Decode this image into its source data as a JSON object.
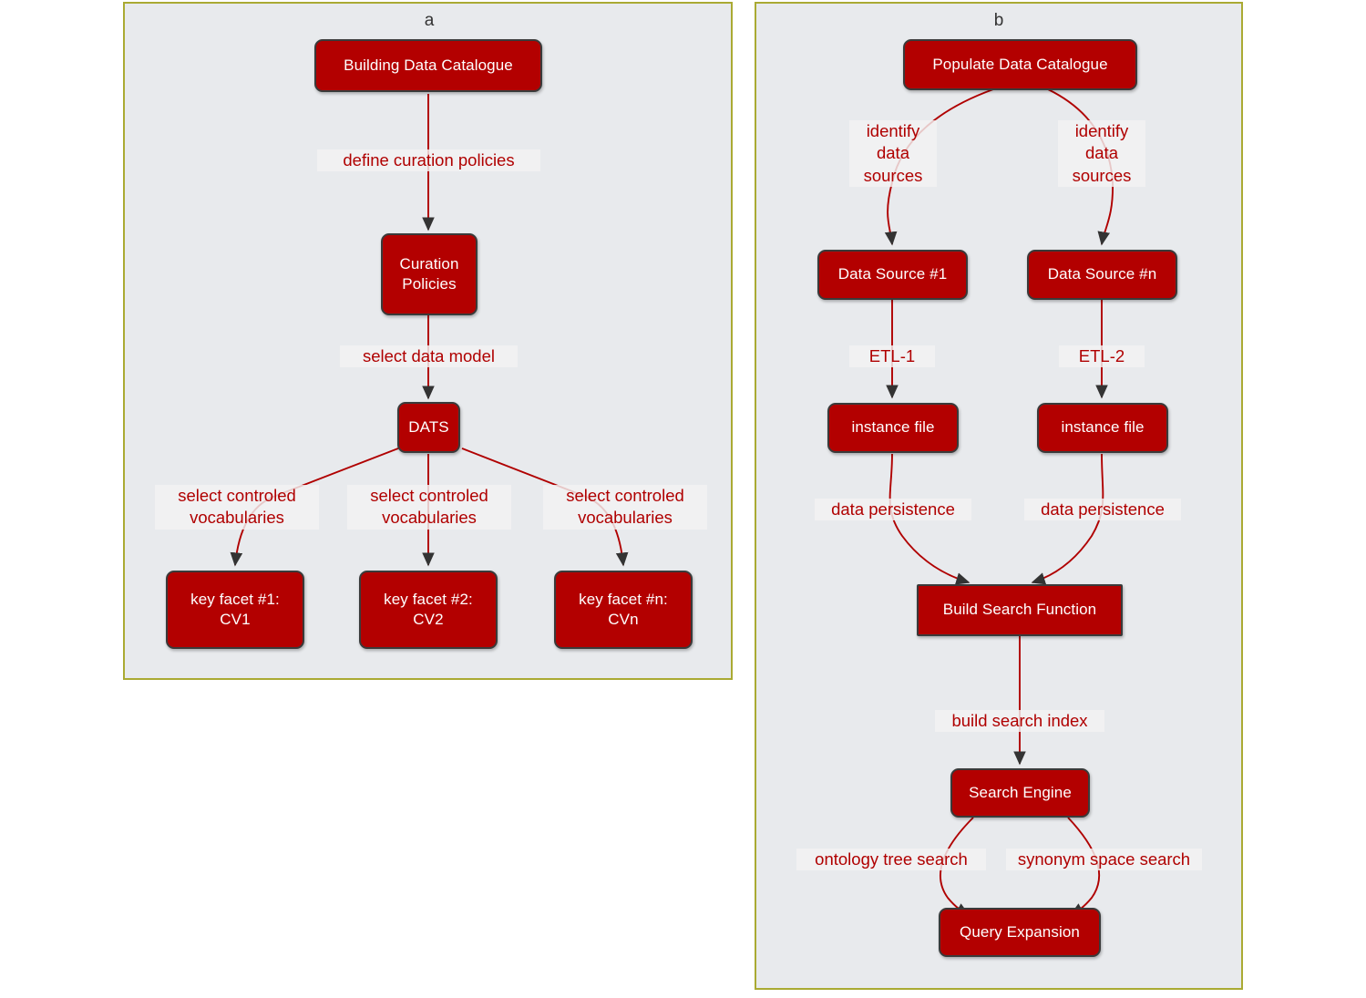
{
  "figure": {
    "background": "#ffffff",
    "panel_fill": "#e8eaed",
    "panel_border": "#aaaa33",
    "node_fill": "#b30000",
    "node_border": "#3a3a3a",
    "node_text": "#ffffff",
    "edge_color": "#b00000",
    "label_text_color": "#b00000"
  },
  "panels": [
    {
      "id": "a",
      "label": "a"
    },
    {
      "id": "b",
      "label": "b"
    }
  ],
  "panel_a": {
    "label": "a",
    "nodes": [
      {
        "id": "building-data-catalogue",
        "text": "Building Data Catalogue"
      },
      {
        "id": "curation-policies",
        "text": "Curation\nPolicies"
      },
      {
        "id": "dats",
        "text": "DATS"
      },
      {
        "id": "key-facet-1",
        "text": "key facet #1:\nCV1"
      },
      {
        "id": "key-facet-2",
        "text": "key facet #2:\nCV2"
      },
      {
        "id": "key-facet-n",
        "text": "key facet #n:\nCVn"
      }
    ],
    "edges": [
      {
        "from": "building-data-catalogue",
        "to": "curation-policies",
        "label": "define curation policies"
      },
      {
        "from": "curation-policies",
        "to": "dats",
        "label": "select data model"
      },
      {
        "from": "dats",
        "to": "key-facet-1",
        "label": "select controled\nvocabularies"
      },
      {
        "from": "dats",
        "to": "key-facet-2",
        "label": "select controled\nvocabularies"
      },
      {
        "from": "dats",
        "to": "key-facet-n",
        "label": "select controled\nvocabularies"
      }
    ]
  },
  "panel_b": {
    "label": "b",
    "nodes": [
      {
        "id": "populate-data-catalogue",
        "text": "Populate Data Catalogue"
      },
      {
        "id": "data-source-1",
        "text": "Data Source #1"
      },
      {
        "id": "data-source-n",
        "text": "Data Source #n"
      },
      {
        "id": "instance-file-1",
        "text": "instance file"
      },
      {
        "id": "instance-file-2",
        "text": "instance file"
      },
      {
        "id": "build-search-function",
        "text": "Build Search Function"
      },
      {
        "id": "search-engine",
        "text": "Search Engine"
      },
      {
        "id": "query-expansion",
        "text": "Query Expansion"
      }
    ],
    "edges": [
      {
        "from": "populate-data-catalogue",
        "to": "data-source-1",
        "label": "identify\ndata\nsources"
      },
      {
        "from": "populate-data-catalogue",
        "to": "data-source-n",
        "label": "identify\ndata\nsources"
      },
      {
        "from": "data-source-1",
        "to": "instance-file-1",
        "label": "ETL-1"
      },
      {
        "from": "data-source-n",
        "to": "instance-file-2",
        "label": "ETL-2"
      },
      {
        "from": "instance-file-1",
        "to": "build-search-function",
        "label": "data persistence"
      },
      {
        "from": "instance-file-2",
        "to": "build-search-function",
        "label": "data persistence"
      },
      {
        "from": "build-search-function",
        "to": "search-engine",
        "label": "build search index"
      },
      {
        "from": "search-engine",
        "to": "query-expansion",
        "label": "ontology tree search"
      },
      {
        "from": "search-engine",
        "to": "query-expansion",
        "label": "synonym space search"
      }
    ]
  }
}
